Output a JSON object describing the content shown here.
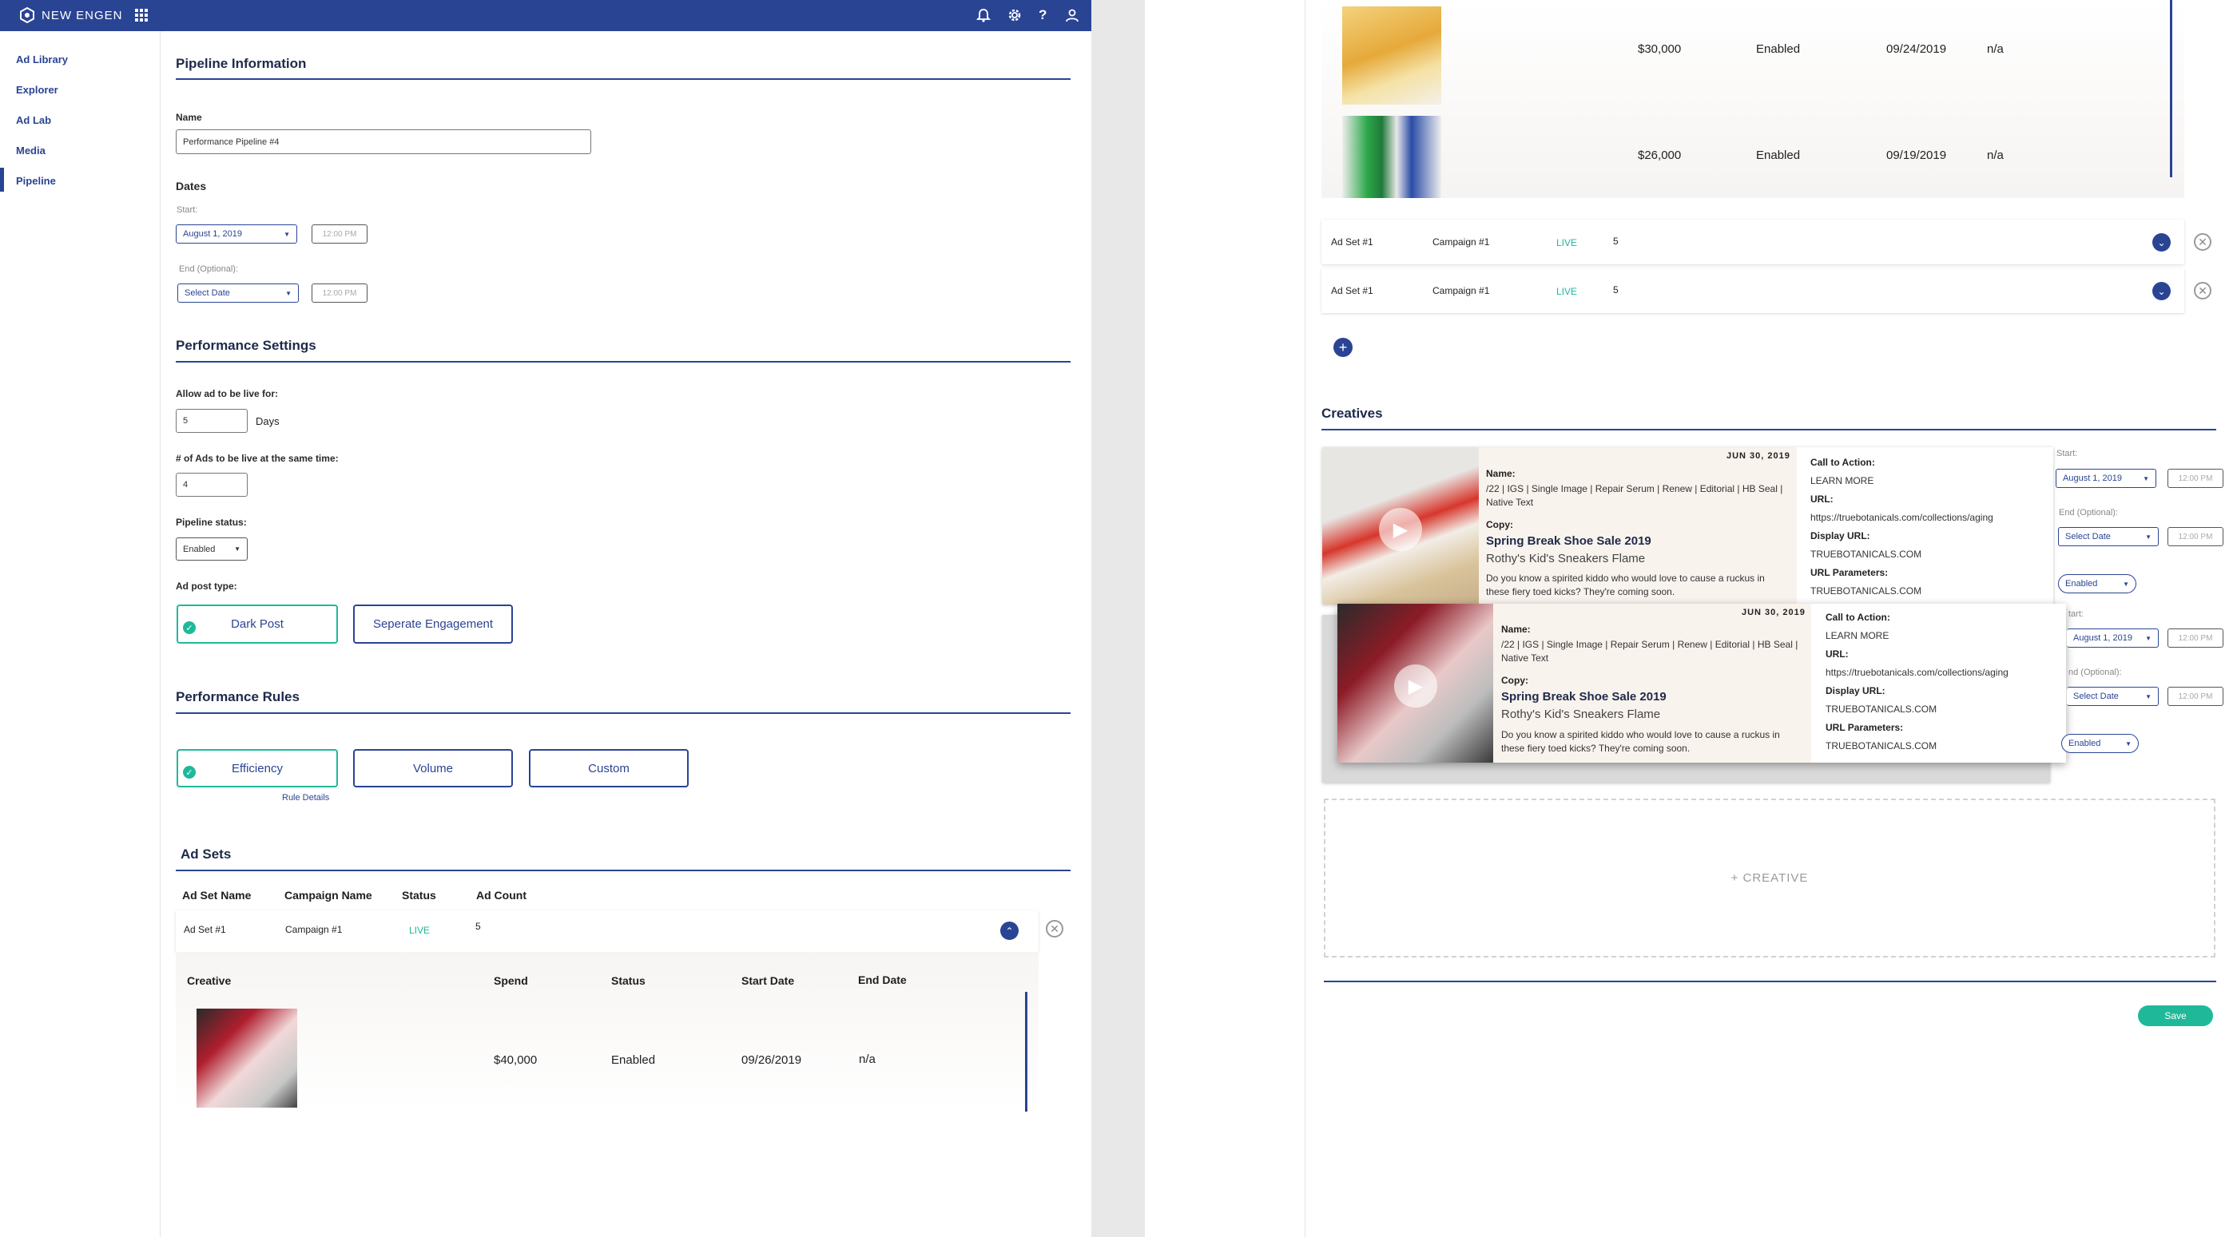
{
  "app": {
    "brand": "NEW ENGEN"
  },
  "sidebar": {
    "items": [
      "Ad Library",
      "Explorer",
      "Ad Lab",
      "Media",
      "Pipeline"
    ],
    "active": "Pipeline"
  },
  "pipeline_info": {
    "title": "Pipeline Information",
    "name_label": "Name",
    "name_value": "Performance Pipeline #4",
    "dates_label": "Dates",
    "start_label": "Start:",
    "start_date": "August 1, 2019",
    "start_time": "12:00 PM",
    "end_label": "End (Optional):",
    "end_date": "Select Date",
    "end_time": "12:00 PM"
  },
  "performance_settings": {
    "title": "Performance Settings",
    "live_for_label": "Allow ad to be live for:",
    "live_for_value": "5",
    "days_label": "Days",
    "ads_live_label": "# of Ads to be live at the same time:",
    "ads_live_value": "4",
    "status_label": "Pipeline status:",
    "status_value": "Enabled",
    "post_type_label": "Ad post type:",
    "post_types": [
      "Dark Post",
      "Seperate Engagement"
    ]
  },
  "performance_rules": {
    "title": "Performance Rules",
    "rules": [
      "Efficiency",
      "Volume",
      "Custom"
    ],
    "rule_details": "Rule Details"
  },
  "ad_sets": {
    "title": "Ad Sets",
    "columns": [
      "Ad Set Name",
      "Campaign Name",
      "Status",
      "Ad Count"
    ],
    "row": {
      "name": "Ad Set #1",
      "campaign": "Campaign #1",
      "status": "LIVE",
      "count": "5"
    },
    "sub_columns": [
      "Creative",
      "Spend",
      "Status",
      "Start Date",
      "End Date"
    ],
    "sub_rows": [
      {
        "spend": "$40,000",
        "status": "Enabled",
        "start": "09/26/2019",
        "end": "n/a"
      }
    ]
  },
  "right_table": {
    "sub_rows": [
      {
        "spend": "$30,000",
        "status": "Enabled",
        "start": "09/24/2019",
        "end": "n/a"
      },
      {
        "spend": "$26,000",
        "status": "Enabled",
        "start": "09/19/2019",
        "end": "n/a"
      }
    ],
    "ad_set_rows": [
      {
        "name": "Ad Set #1",
        "campaign": "Campaign #1",
        "status": "LIVE",
        "count": "5"
      },
      {
        "name": "Ad Set #1",
        "campaign": "Campaign #1",
        "status": "LIVE",
        "count": "5"
      }
    ]
  },
  "creatives": {
    "title": "Creatives",
    "cards": [
      {
        "date": "JUN 30, 2019",
        "name_label": "Name:",
        "name_value": "/22 | IGS | Single Image | Repair Serum | Renew | Editorial | HB Seal | Native Text",
        "copy_label": "Copy:",
        "headline": "Spring Break Shoe Sale 2019",
        "subhead": "Rothy's Kid's Sneakers Flame",
        "body": "Do you know a spirited kiddo who would love to cause a ruckus in these fiery toed kicks? They're coming soon.",
        "cta_label": "Call to Action:",
        "cta_value": "LEARN MORE",
        "url_label": "URL:",
        "url_value": "https://truebotanicals.com/collections/aging",
        "display_url_label": "Display URL:",
        "display_url_value": "TRUEBOTANICALS.COM",
        "url_params_label": "URL Parameters:",
        "url_params_value": "TRUEBOTANICALS.COM",
        "start_label": "Start:",
        "start_date": "August 1, 2019",
        "start_time": "12:00 PM",
        "end_label": "End (Optional):",
        "end_date": "Select Date",
        "end_time": "12:00 PM",
        "status": "Enabled"
      },
      {
        "date": "JUN 30, 2019",
        "name_label": "Name:",
        "name_value": "/22 | IGS | Single Image | Repair Serum | Renew | Editorial | HB Seal | Native Text",
        "copy_label": "Copy:",
        "headline": "Spring Break Shoe Sale 2019",
        "subhead": "Rothy's Kid's Sneakers Flame",
        "body": "Do you know a spirited kiddo who would love to cause a ruckus in these fiery toed kicks? They're coming soon.",
        "cta_label": "Call to Action:",
        "cta_value": "LEARN MORE",
        "url_label": "URL:",
        "url_value": "https://truebotanicals.com/collections/aging",
        "display_url_label": "Display URL:",
        "display_url_value": "TRUEBOTANICALS.COM",
        "url_params_label": "URL Parameters:",
        "url_params_value": "TRUEBOTANICALS.COM",
        "start_label": "tart:",
        "start_date": "August 1, 2019",
        "start_time": "12:00 PM",
        "end_label": "nd (Optional):",
        "end_date": "Select Date",
        "end_time": "12:00 PM",
        "status": "Enabled"
      }
    ],
    "add_creative": "+ CREATIVE",
    "save": "Save"
  },
  "colors": {
    "primary": "#2a4494",
    "accent": "#1fb99a"
  },
  "icons": [
    "brand-logo-icon",
    "apps-grid-icon",
    "bell-icon",
    "gear-icon",
    "help-icon",
    "user-icon",
    "check-icon",
    "chevron-down-icon",
    "chevron-up-icon",
    "close-icon",
    "plus-icon",
    "play-icon"
  ]
}
